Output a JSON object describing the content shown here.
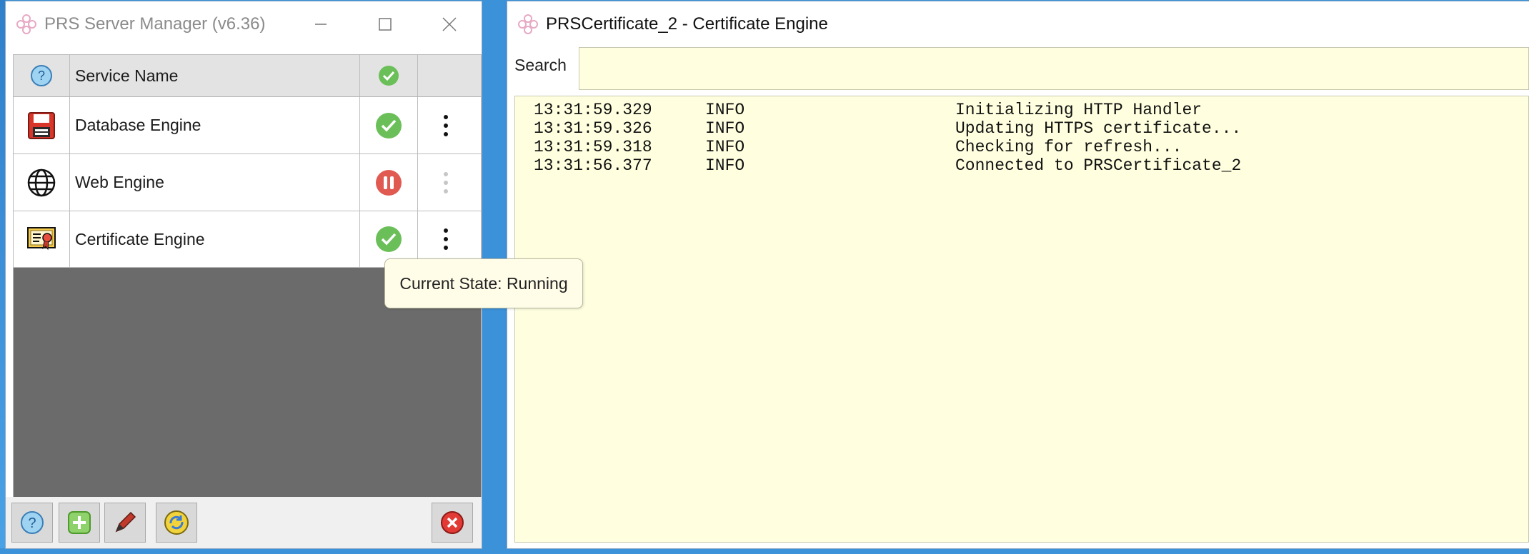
{
  "server_manager": {
    "title": "PRS Server Manager (v6.36)",
    "column_header": "Service Name",
    "services": [
      {
        "name": "Database Engine",
        "icon": "floppy-disk-icon",
        "state": "running"
      },
      {
        "name": "Web Engine",
        "icon": "globe-icon",
        "state": "paused"
      },
      {
        "name": "Certificate Engine",
        "icon": "certificate-icon",
        "state": "running"
      }
    ],
    "toolbar_buttons": [
      "help-icon",
      "add-icon",
      "edit-icon",
      "refresh-icon",
      "close-icon"
    ],
    "tooltip": "Current State: Running",
    "colors": {
      "running": "#6bbf59",
      "paused": "#e05a52",
      "grid_bg": "#6b6b6b"
    }
  },
  "cert_window": {
    "title": "PRSCertificate_2 - Certificate Engine",
    "search_label": "Search",
    "search_value": "",
    "log": [
      {
        "time": "13:31:59.329",
        "level": "INFO",
        "message": "Initializing HTTP Handler"
      },
      {
        "time": "13:31:59.326",
        "level": "INFO",
        "message": "Updating HTTPS certificate..."
      },
      {
        "time": "13:31:59.318",
        "level": "INFO",
        "message": "Checking for refresh..."
      },
      {
        "time": "13:31:56.377",
        "level": "INFO",
        "message": "Connected to PRSCertificate_2"
      }
    ],
    "colors": {
      "log_bg": "#ffffe0"
    }
  }
}
